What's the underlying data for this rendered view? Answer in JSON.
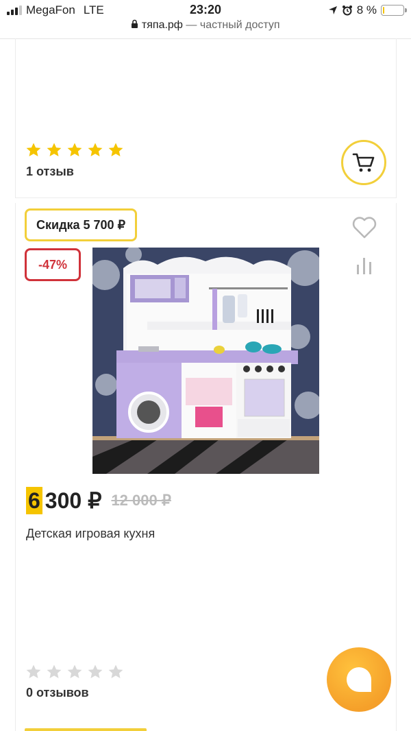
{
  "status_bar": {
    "carrier": "MegaFon",
    "network": "LTE",
    "time": "23:20",
    "battery": "8 %",
    "battery_level": 0.08
  },
  "url_bar": {
    "domain": "тяпа.рф",
    "suffix": " — частный доступ"
  },
  "products": [
    {
      "rating_stars": 5,
      "reviews_label": "1 отзыв",
      "cart_icon": "cart-icon"
    },
    {
      "discount_label": "Скидка 5 700 ₽",
      "percent_label": "-47%",
      "price_first_digit": "6",
      "price_rest": "300 ₽",
      "old_price": "12 000 ₽",
      "name": "Детская игровая кухня",
      "rating_stars": 0,
      "reviews_label": "0 отзывов"
    }
  ],
  "colors": {
    "accent_yellow": "#f2cf3a",
    "discount_red": "#d0323a",
    "star_filled": "#f5c400",
    "star_empty": "#d8d8d8",
    "chat_orange": "#f5a02a"
  }
}
